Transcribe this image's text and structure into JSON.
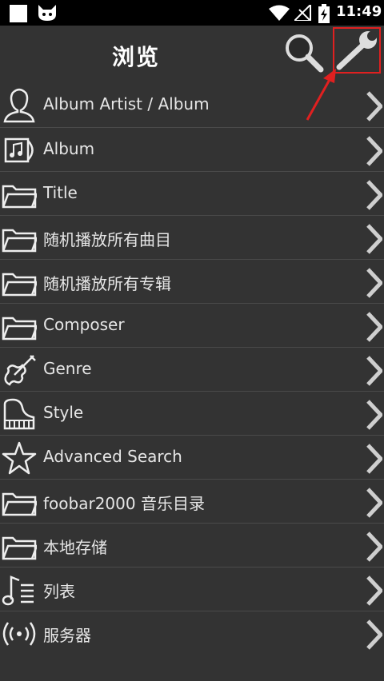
{
  "status_bar": {
    "time": "11:49"
  },
  "header": {
    "title": "浏览"
  },
  "items": [
    {
      "label": "Album Artist / Album",
      "icon": "person-icon"
    },
    {
      "label": "Album",
      "icon": "album-icon"
    },
    {
      "label": "Title",
      "icon": "folder-icon"
    },
    {
      "label": "随机播放所有曲目",
      "icon": "folder-icon"
    },
    {
      "label": "随机播放所有专辑",
      "icon": "folder-icon"
    },
    {
      "label": "Composer",
      "icon": "folder-icon"
    },
    {
      "label": "Genre",
      "icon": "violin-icon"
    },
    {
      "label": "Style",
      "icon": "piano-icon"
    },
    {
      "label": "Advanced Search",
      "icon": "star-icon"
    },
    {
      "label": "foobar2000 音乐目录",
      "icon": "folder-icon"
    },
    {
      "label": "本地存储",
      "icon": "folder-icon"
    },
    {
      "label": "列表",
      "icon": "playlist-icon"
    },
    {
      "label": "服务器",
      "icon": "broadcast-icon"
    }
  ],
  "colors": {
    "background": "#333333",
    "status_bar": "#000000",
    "highlight": "#e02020"
  }
}
